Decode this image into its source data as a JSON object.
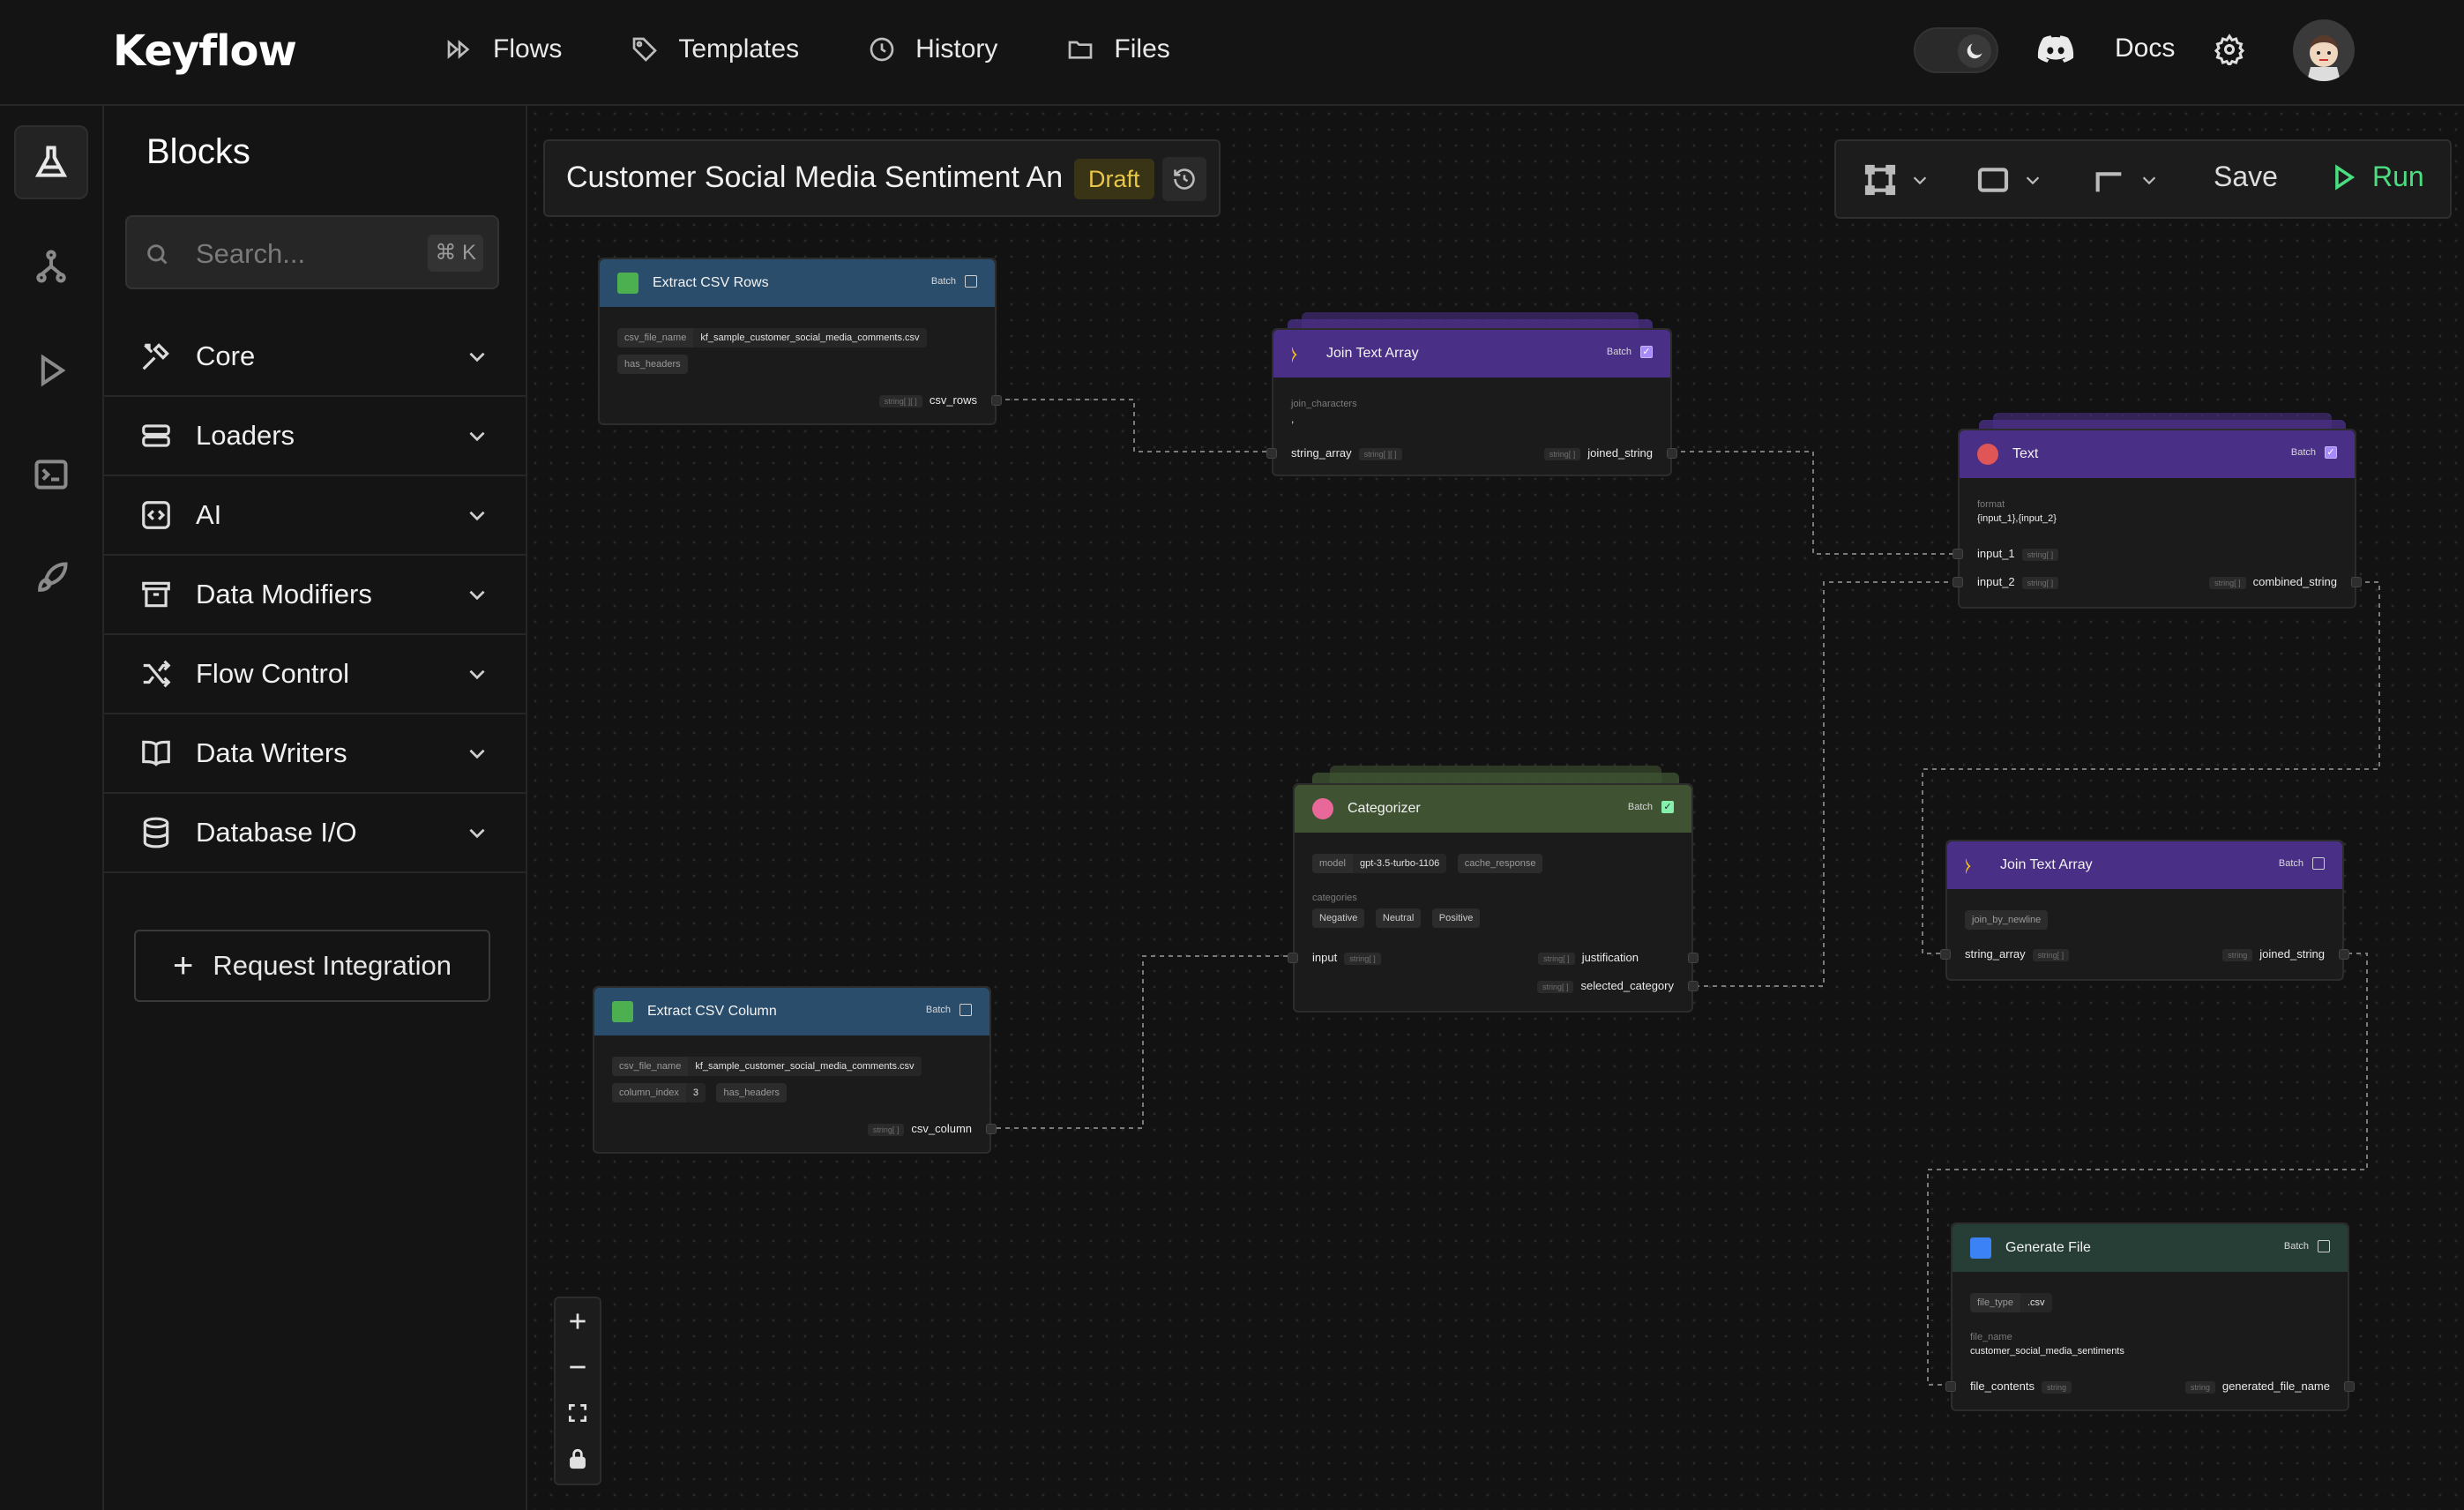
{
  "app": {
    "logo": "Keyflow"
  },
  "nav": [
    {
      "label": "Flows"
    },
    {
      "label": "Templates"
    },
    {
      "label": "History"
    },
    {
      "label": "Files"
    }
  ],
  "header_right": {
    "docs": "Docs"
  },
  "panel": {
    "title": "Blocks",
    "search_placeholder": "Search...",
    "search_shortcut": "⌘ K",
    "categories": [
      {
        "label": "Core"
      },
      {
        "label": "Loaders"
      },
      {
        "label": "AI"
      },
      {
        "label": "Data Modifiers"
      },
      {
        "label": "Flow Control"
      },
      {
        "label": "Data Writers"
      },
      {
        "label": "Database I/O"
      }
    ],
    "request_button": "Request Integration"
  },
  "flow": {
    "title": "Customer Social Media Sentiment An",
    "status": "Draft"
  },
  "toolbar": {
    "save": "Save",
    "run": "Run"
  },
  "nodes": {
    "extract_rows": {
      "title": "Extract CSV Rows",
      "batch": "Batch",
      "file_key": "csv_file_name",
      "file_val": "kf_sample_customer_social_media_comments.csv",
      "has_headers": "has_headers",
      "out_type": "string[ ][ ]",
      "out": "csv_rows"
    },
    "join1": {
      "title": "Join Text Array",
      "batch": "Batch",
      "join_label": "join_characters",
      "join_value": ",",
      "in": "string_array",
      "in_type": "string[ ][ ]",
      "out_type": "string[ ]",
      "out": "joined_string"
    },
    "text": {
      "title": "Text",
      "batch": "Batch",
      "format_label": "format",
      "format_value": "{input_1},{input_2}",
      "in1": "input_1",
      "in2": "input_2",
      "in_type": "string[ ]",
      "out_type": "string[ ]",
      "out": "combined_string"
    },
    "categorizer": {
      "title": "Categorizer",
      "batch": "Batch",
      "model_key": "model",
      "model_val": "gpt-3.5-turbo-1106",
      "cache": "cache_response",
      "cat_label": "categories",
      "cats": [
        "Negative",
        "Neutral",
        "Positive"
      ],
      "in": "input",
      "in_type": "string[ ]",
      "out_type": "string[ ]",
      "out1": "justification",
      "out2": "selected_category"
    },
    "join2": {
      "title": "Join Text Array",
      "batch": "Batch",
      "join_by": "join_by_newline",
      "in": "string_array",
      "in_type": "string[ ]",
      "out_type": "string",
      "out": "joined_string"
    },
    "extract_col": {
      "title": "Extract CSV Column",
      "batch": "Batch",
      "file_key": "csv_file_name",
      "file_val": "kf_sample_customer_social_media_comments.csv",
      "col_key": "column_index",
      "col_val": "3",
      "has_headers": "has_headers",
      "out_type": "string[ ]",
      "out": "csv_column"
    },
    "genfile": {
      "title": "Generate File",
      "batch": "Batch",
      "type_key": "file_type",
      "type_val": ".csv",
      "name_label": "file_name",
      "name_val": "customer_social_media_sentiments",
      "in": "file_contents",
      "in_type": "string",
      "out_type": "string",
      "out": "generated_file_name"
    }
  },
  "colors": {
    "accent_green": "#4ade80",
    "draft": "#e8c64a",
    "node_blue": "#2b4d6c",
    "node_purple": "#4a2f86",
    "node_olive": "#3f5232",
    "node_green": "#263e35"
  }
}
